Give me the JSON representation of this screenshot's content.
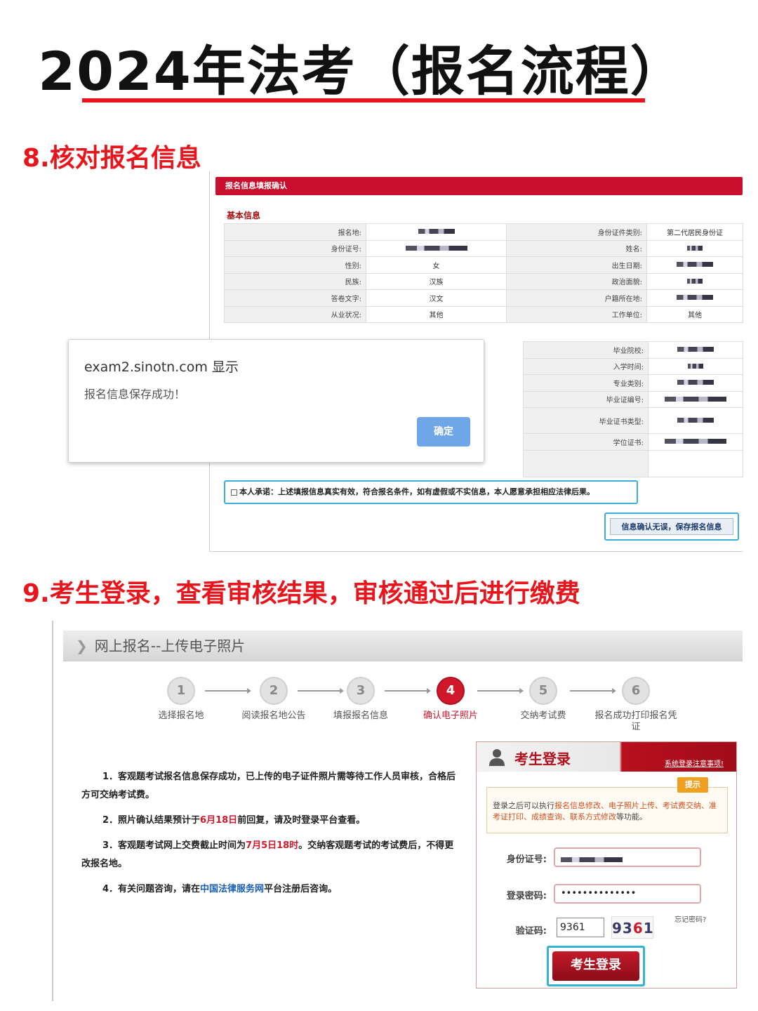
{
  "title": "2024年法考（报名流程）",
  "colors": {
    "accent_red": "#e8161c",
    "highlight_cyan": "#3ab0d8",
    "dialog_button": "#6ea6e8"
  },
  "section8": {
    "heading": "8.核对报名信息",
    "panel_title": "报名信息填报确认",
    "basic_info_label": "基本信息",
    "rows": [
      {
        "l1": "报名地:",
        "v1": "",
        "l2": "身份证件类别:",
        "v2": "第二代居民身份证"
      },
      {
        "l1": "身份证号:",
        "v1": "",
        "l2": "姓名:",
        "v2": ""
      },
      {
        "l1": "性别:",
        "v1": "女",
        "l2": "出生日期:",
        "v2": ""
      },
      {
        "l1": "民族:",
        "v1": "汉族",
        "l2": "政治面貌:",
        "v2": ""
      },
      {
        "l1": "答卷文字:",
        "v1": "汉文",
        "l2": "户籍所在地:",
        "v2": ""
      },
      {
        "l1": "从业状况:",
        "v1": "其他",
        "l2": "工作单位:",
        "v2": "其他"
      }
    ],
    "edu_rows": [
      {
        "label": "毕业院校:"
      },
      {
        "label": "入学时间:"
      },
      {
        "label": "专业类别:"
      },
      {
        "label": "毕业证编号:"
      },
      {
        "label": "毕业证书类型:"
      },
      {
        "label": "学位证书:"
      }
    ],
    "pledge": "本人承诺：上述填报信息真实有效，符合报名条件，如有虚假或不实信息，本人愿意承担相应法律后果。",
    "confirm_button": "信息确认无误，保存报名信息",
    "dialog": {
      "title": "exam2.sinotn.com 显示",
      "message": "报名信息保存成功！",
      "ok_button": "确定"
    }
  },
  "section9": {
    "heading": "9.考生登录，查看审核结果，审核通过后进行缴费",
    "panel_title": "网上报名--上传电子照片",
    "steps": [
      {
        "num": "1",
        "label": "选择报名地"
      },
      {
        "num": "2",
        "label": "阅读报名地公告"
      },
      {
        "num": "3",
        "label": "填报报名信息"
      },
      {
        "num": "4",
        "label": "确认电子照片"
      },
      {
        "num": "5",
        "label": "交纳考试费"
      },
      {
        "num": "6",
        "label": "报名成功打印报名凭证"
      }
    ],
    "active_step": 4,
    "notes": {
      "n1": "1．客观题考试报名信息保存成功，已上传的电子证件照片需等待工作人员审核，合格后方可交纳考试费。",
      "n2_a": "2．照片确认结果预计于",
      "n2_red": "6月18日",
      "n2_b": "前回复，请及时登录平台查看。",
      "n3_a": "3．客观题考试网上交费截止时间为",
      "n3_red": "7月5日18时",
      "n3_b": "。交纳客观题考试的考试费后，不得更改报名地。",
      "n4_a": "4．有关问题咨询，请在",
      "n4_blue": "中国法律服务网",
      "n4_b": "平台注册后咨询。"
    },
    "login": {
      "title": "考生登录",
      "notice_link": "系统登录注意事项!",
      "tip_badge": "提示",
      "tip_a": "登录之后可以执行",
      "tip_hl1": "报名信息修改、电子照片上传、考试费交纳、准考证打印、成绩查询、联系方式修改",
      "tip_b": "等功能。",
      "id_label": "身份证号:",
      "password_label": "登录密码:",
      "password_value": "••••••••••••••",
      "captcha_label": "验证码:",
      "captcha_value": "9361",
      "captcha_image_a": "93",
      "captcha_image_b": "6",
      "captcha_image_c": "1",
      "forgot": "忘记密码?",
      "login_button": "考生登录"
    }
  }
}
